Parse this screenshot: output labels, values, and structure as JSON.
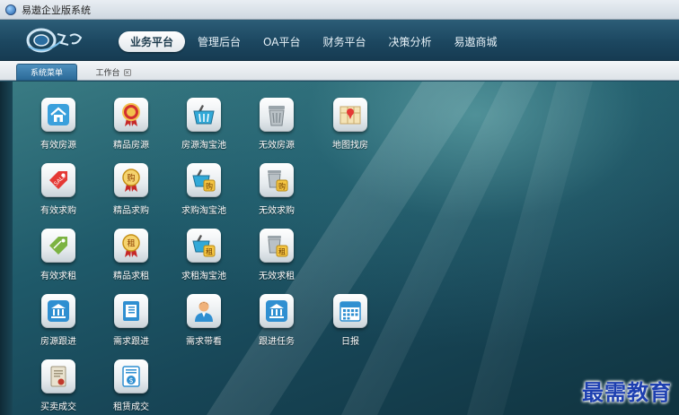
{
  "window": {
    "title": "易遨企业版系统"
  },
  "navbar": {
    "items": [
      {
        "label": "业务平台",
        "active": true
      },
      {
        "label": "管理后台",
        "active": false
      },
      {
        "label": "OA平台",
        "active": false
      },
      {
        "label": "财务平台",
        "active": false
      },
      {
        "label": "决策分析",
        "active": false
      },
      {
        "label": "易遨商城",
        "active": false
      }
    ]
  },
  "tabs": [
    {
      "label": "系统菜单",
      "active": true
    },
    {
      "label": "工作台",
      "active": false,
      "closable": true
    }
  ],
  "desktop_icons": [
    {
      "label": "有效房源",
      "icon": "house-icon"
    },
    {
      "label": "精品房源",
      "icon": "award-badge-icon"
    },
    {
      "label": "房源淘宝池",
      "icon": "basket-icon"
    },
    {
      "label": "无效房源",
      "icon": "trash-can-icon"
    },
    {
      "label": "地图找房",
      "icon": "map-pin-icon"
    },
    {
      "label": "有效求购",
      "icon": "sale-tag-icon"
    },
    {
      "label": "精品求购",
      "icon": "buy-badge-icon",
      "badge_text": "购"
    },
    {
      "label": "求购淘宝池",
      "icon": "basket-buy-icon",
      "badge_text": "购"
    },
    {
      "label": "无效求购",
      "icon": "trash-buy-icon",
      "badge_text": "购"
    },
    {
      "label": "有效求租",
      "icon": "rent-tag-icon"
    },
    {
      "label": "精品求租",
      "icon": "rent-badge-icon",
      "badge_text": "租"
    },
    {
      "label": "求租淘宝池",
      "icon": "basket-rent-icon",
      "badge_text": "租"
    },
    {
      "label": "无效求租",
      "icon": "trash-rent-icon",
      "badge_text": "租"
    },
    {
      "label": "房源跟进",
      "icon": "bank-building-icon"
    },
    {
      "label": "需求跟进",
      "icon": "document-icon"
    },
    {
      "label": "需求带看",
      "icon": "person-icon"
    },
    {
      "label": "跟进任务",
      "icon": "bank-building-icon"
    },
    {
      "label": "日报",
      "icon": "calendar-icon"
    },
    {
      "label": "买卖成交",
      "icon": "contract-icon"
    },
    {
      "label": "租赁成交",
      "icon": "dollar-document-icon"
    }
  ],
  "watermark": {
    "text": "最需教育"
  },
  "colors": {
    "nav_bg": "#1c4760",
    "tab_active": "#2b6a98",
    "desktop_bg": "#174556",
    "watermark": "#1d3fb0"
  }
}
